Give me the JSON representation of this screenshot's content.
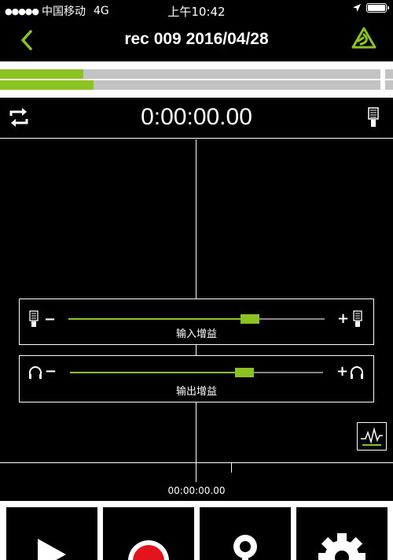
{
  "status_bar": {
    "signal_dots": "●●●●●",
    "carrier": "中国移动",
    "network": "4G",
    "time": "上午10:42",
    "icons": [
      "location-arrow-icon",
      "battery-icon"
    ]
  },
  "nav": {
    "back_icon": "chevron-left-icon",
    "title": "rec 009 2016/04/28",
    "logo_icon": "app-logo-icon"
  },
  "level_meters": {
    "channel_1_level": 0.22,
    "channel_2_level": 0.245
  },
  "timer": {
    "elapsed": "0:00:00.00",
    "loop_icon": "loop-icon",
    "mic_icon": "microphone-icon"
  },
  "input_gain": {
    "label": "输入增益",
    "minus": "−",
    "plus": "+",
    "level": 0.71,
    "icon": "microphone-icon"
  },
  "output_gain": {
    "label": "输出增益",
    "minus": "−",
    "plus": "+",
    "level": 0.69,
    "icon": "headphones-icon"
  },
  "timeline": {
    "position": "00:00:00.00"
  },
  "toolbar": {
    "buttons": [
      "play-icon",
      "record-icon",
      "marker-pin-icon",
      "gear-icon"
    ]
  },
  "colors": {
    "accent": "#8cc322",
    "meter_bg": "#c3c3c3",
    "record": "#e3141b"
  }
}
